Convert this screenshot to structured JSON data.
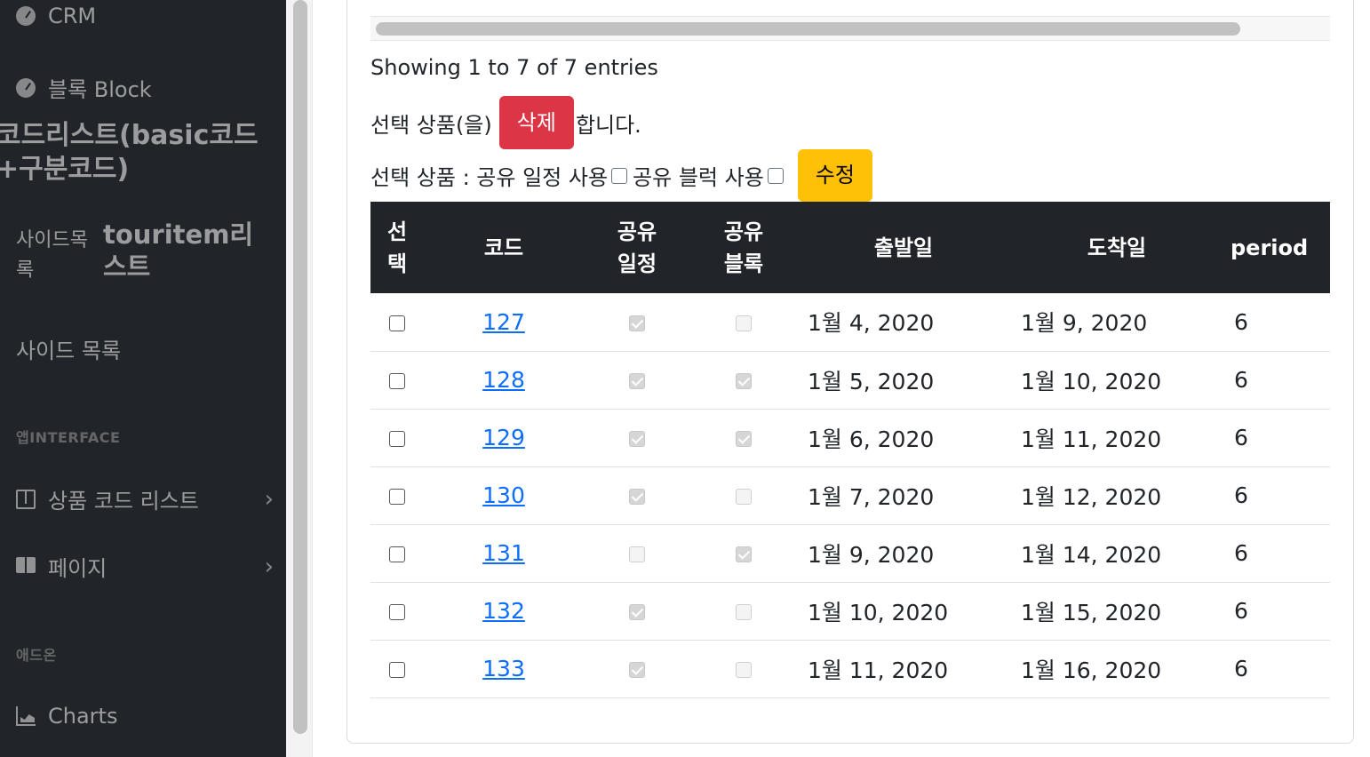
{
  "sidebar": {
    "crm": "CRM",
    "block": "블록 Block",
    "code_list_title": "코드리스트(basic코드+구분코드)",
    "side_list_left": "사이드목록",
    "touritem_list": "touritem리스트",
    "side_list": "사이드 목록",
    "app_heading": "앱INTERFACE",
    "product_code_list": "상품 코드 리스트",
    "page": "페이지",
    "addon_heading": "애드온",
    "charts": "Charts"
  },
  "main": {
    "entries_info": "Showing 1 to 7 of 7 entries",
    "delete_prefix": "선택 상품(을)",
    "delete_button": "삭제",
    "delete_suffix": "합니다.",
    "edit_prefix": "선택 상품 : 공유 일정 사용",
    "edit_middle": "공유 블럭 사용",
    "edit_button": "수정",
    "share_schedule_checked": false,
    "share_block_checked": false
  },
  "table": {
    "headers": {
      "select": "선택",
      "code": "코드",
      "share_schedule": "공유일정",
      "share_block": "공유블록",
      "departure": "출발일",
      "arrival": "도착일",
      "period": "period"
    },
    "rows": [
      {
        "code": "127",
        "share_schedule": true,
        "share_block": false,
        "departure": "1월 4, 2020",
        "arrival": "1월 9, 2020",
        "period": "6"
      },
      {
        "code": "128",
        "share_schedule": true,
        "share_block": true,
        "departure": "1월 5, 2020",
        "arrival": "1월 10, 2020",
        "period": "6"
      },
      {
        "code": "129",
        "share_schedule": true,
        "share_block": true,
        "departure": "1월 6, 2020",
        "arrival": "1월 11, 2020",
        "period": "6"
      },
      {
        "code": "130",
        "share_schedule": true,
        "share_block": false,
        "departure": "1월 7, 2020",
        "arrival": "1월 12, 2020",
        "period": "6"
      },
      {
        "code": "131",
        "share_schedule": false,
        "share_block": true,
        "departure": "1월 9, 2020",
        "arrival": "1월 14, 2020",
        "period": "6"
      },
      {
        "code": "132",
        "share_schedule": true,
        "share_block": false,
        "departure": "1월 10, 2020",
        "arrival": "1월 15, 2020",
        "period": "6"
      },
      {
        "code": "133",
        "share_schedule": true,
        "share_block": false,
        "departure": "1월 11, 2020",
        "arrival": "1월 16, 2020",
        "period": "6"
      }
    ]
  },
  "colors": {
    "sidebar_bg": "#212529",
    "delete_button": "#dc3545",
    "edit_button": "#ffc107",
    "table_header_bg": "#212529",
    "link": "#0d6efd"
  }
}
